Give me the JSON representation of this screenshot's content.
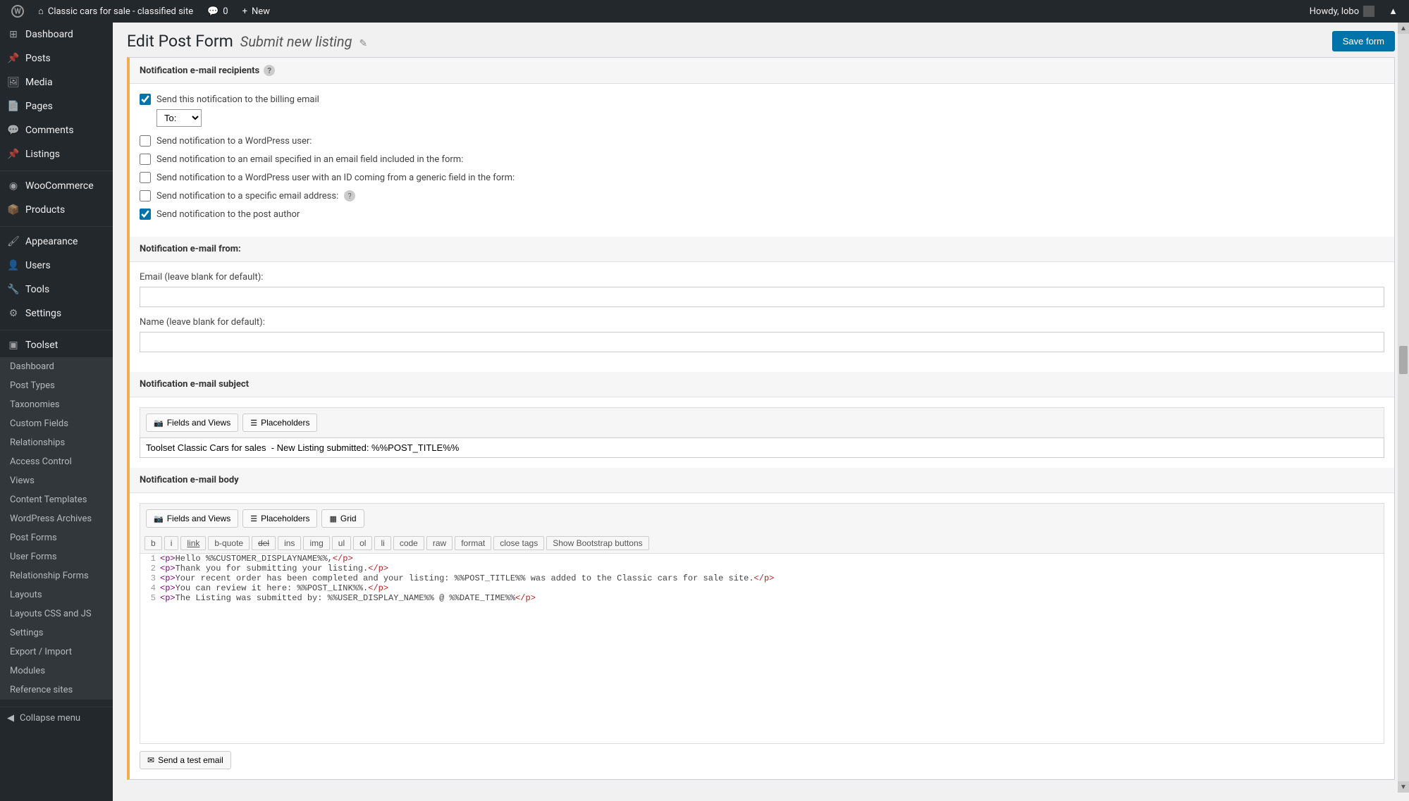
{
  "admin_bar": {
    "site_name": "Classic cars for sale - classified site",
    "comment_count": "0",
    "new_label": "New",
    "howdy": "Howdy, lobo"
  },
  "sidebar": {
    "items": [
      {
        "label": "Dashboard",
        "icon": "dashboard"
      },
      {
        "label": "Posts",
        "icon": "pin"
      },
      {
        "label": "Media",
        "icon": "media"
      },
      {
        "label": "Pages",
        "icon": "page"
      },
      {
        "label": "Comments",
        "icon": "comment"
      },
      {
        "label": "Listings",
        "icon": "pin"
      },
      {
        "label": "WooCommerce",
        "icon": "woo"
      },
      {
        "label": "Products",
        "icon": "product"
      },
      {
        "label": "Appearance",
        "icon": "brush"
      },
      {
        "label": "Users",
        "icon": "user"
      },
      {
        "label": "Tools",
        "icon": "tool"
      },
      {
        "label": "Settings",
        "icon": "settings"
      },
      {
        "label": "Toolset",
        "icon": "toolset"
      }
    ],
    "submenu": [
      "Dashboard",
      "Post Types",
      "Taxonomies",
      "Custom Fields",
      "Relationships",
      "Access Control",
      "Views",
      "Content Templates",
      "WordPress Archives",
      "Post Forms",
      "User Forms",
      "Relationship Forms",
      "Layouts",
      "Layouts CSS and JS",
      "Settings",
      "Export / Import",
      "Modules",
      "Reference sites"
    ],
    "collapse": "Collapse menu"
  },
  "header": {
    "title": "Edit Post Form",
    "subtitle": "Submit new listing",
    "save_btn": "Save form"
  },
  "sections": {
    "recipients": {
      "title": "Notification e-mail recipients",
      "checks": [
        {
          "label": "Send this notification to the billing email",
          "checked": true
        },
        {
          "label": "Send notification to a WordPress user:",
          "checked": false
        },
        {
          "label": "Send notification to an email specified in an email field included in the form:",
          "checked": false
        },
        {
          "label": "Send notification to a WordPress user with an ID coming from a generic field in the form:",
          "checked": false
        },
        {
          "label": "Send notification to a specific email address:",
          "checked": false,
          "help": true
        },
        {
          "label": "Send notification to the post author",
          "checked": true
        }
      ],
      "to_label": "To:"
    },
    "from": {
      "title": "Notification e-mail from:",
      "email_label": "Email (leave blank for default):",
      "name_label": "Name (leave blank for default):"
    },
    "subject": {
      "title": "Notification e-mail subject",
      "fields_views": "Fields and Views",
      "placeholders": "Placeholders",
      "value": "Toolset Classic Cars for sales  - New Listing submitted: %%POST_TITLE%%"
    },
    "body": {
      "title": "Notification e-mail body",
      "fields_views": "Fields and Views",
      "placeholders": "Placeholders",
      "grid": "Grid",
      "qt_buttons": [
        "b",
        "i",
        "link",
        "b-quote",
        "del",
        "ins",
        "img",
        "ul",
        "ol",
        "li",
        "code",
        "raw",
        "format",
        "close tags",
        "Show Bootstrap buttons"
      ],
      "code_lines": [
        {
          "n": "1",
          "open": "<p>",
          "text": "Hello %%CUSTOMER_DISPLAYNAME%%,",
          "close": "</p>"
        },
        {
          "n": "2",
          "open": "<p>",
          "text": "Thank you for submitting your listing.",
          "close": "</p>"
        },
        {
          "n": "3",
          "open": "<p>",
          "text": "Your recent order has been completed and your listing: %%POST_TITLE%% was added to the Classic cars for sale site.",
          "close": "</p>"
        },
        {
          "n": "4",
          "open": "<p>",
          "text": "You can review it here: %%POST_LINK%%.",
          "close": "</p>"
        },
        {
          "n": "5",
          "open": "<p>",
          "text": "The Listing was submitted by: %%USER_DISPLAY_NAME%% @ %%DATE_TIME%%",
          "close": "</p>"
        }
      ],
      "test_email": "Send a test email"
    }
  }
}
